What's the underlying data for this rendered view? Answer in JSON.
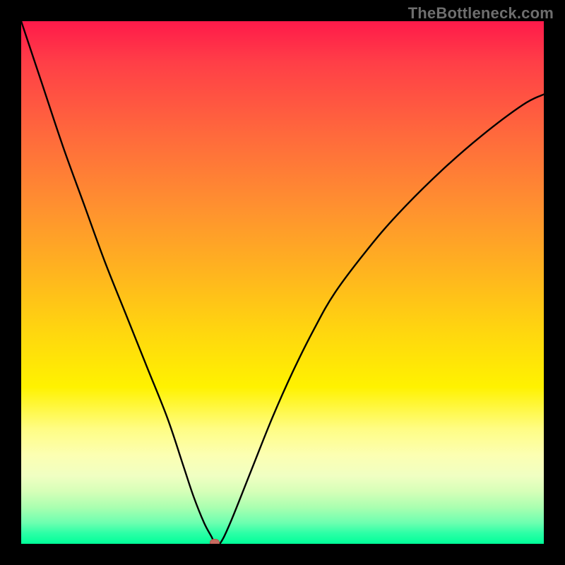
{
  "watermark": "TheBottleneck.com",
  "colors": {
    "frame": "#000000",
    "curve": "#000000",
    "marker": "#c76a5f",
    "gradient_top": "#ff1a4a",
    "gradient_bottom": "#00ff99"
  },
  "chart_data": {
    "type": "line",
    "title": "",
    "xlabel": "",
    "ylabel": "",
    "xlim": [
      0,
      100
    ],
    "ylim": [
      0,
      100
    ],
    "grid": false,
    "legend": false,
    "marker": {
      "x": 37,
      "y": 0,
      "radius_px": 7
    },
    "series": [
      {
        "name": "bottleneck-curve",
        "x": [
          0,
          4,
          8,
          12,
          16,
          20,
          24,
          28,
          31,
          33,
          35,
          36.5,
          37,
          38,
          40,
          44,
          48,
          52,
          56,
          60,
          66,
          72,
          80,
          88,
          96,
          100
        ],
        "y": [
          100,
          88,
          76,
          65,
          54,
          44,
          34,
          24,
          15,
          9,
          4,
          1.2,
          0,
          0,
          4,
          14,
          24,
          33,
          41,
          48,
          56,
          63,
          71,
          78,
          84,
          86
        ]
      }
    ]
  }
}
